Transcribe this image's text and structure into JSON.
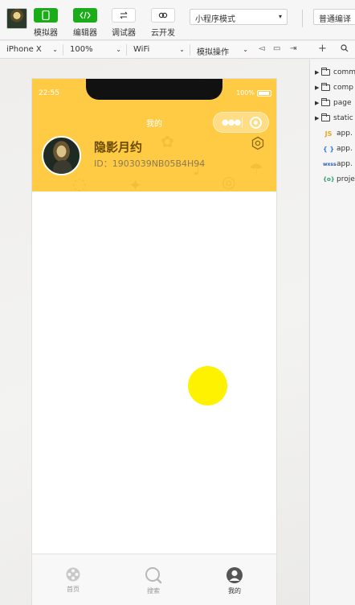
{
  "toolbar": {
    "simulator_label": "模拟器",
    "editor_label": "编辑器",
    "debugger_label": "调试器",
    "cloud_label": "云开发",
    "mode_select": "小程序模式",
    "compile_select": "普通编译"
  },
  "subbar": {
    "device": "iPhone X",
    "zoom": "100%",
    "network": "WiFi",
    "operation": "模拟操作"
  },
  "phone": {
    "status_time": "22:55",
    "battery": "100%",
    "nav_title": "我的",
    "user_name": "隐影月约",
    "user_id": "ID：1903039NB05B4H94",
    "tabs": [
      {
        "label": "首页",
        "icon": "film-reel-icon"
      },
      {
        "label": "搜索",
        "icon": "search-icon"
      },
      {
        "label": "我的",
        "icon": "user-icon"
      }
    ],
    "colors": {
      "header": "#ffcb45",
      "ball": "#fff200"
    }
  },
  "filetree": {
    "items": [
      {
        "name": "comm",
        "kind": "folder"
      },
      {
        "name": "comp",
        "kind": "folder"
      },
      {
        "name": "page",
        "kind": "folder"
      },
      {
        "name": "static",
        "kind": "folder"
      },
      {
        "name": "app.",
        "kind": "js",
        "badge": "JS"
      },
      {
        "name": "app.",
        "kind": "json",
        "badge": "{ }"
      },
      {
        "name": "app.",
        "kind": "wxss",
        "badge": "wxss"
      },
      {
        "name": "proje",
        "kind": "config",
        "badge": "{o}"
      }
    ]
  }
}
